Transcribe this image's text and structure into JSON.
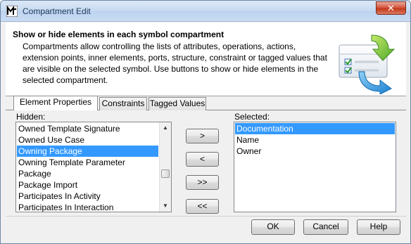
{
  "window": {
    "title": "Compartment Edit",
    "close_label": "✕"
  },
  "header": {
    "title": "Show or hide elements in each symbol compartment",
    "description": "Compartments allow controlling the lists of attributes, operations, actions, extension points, inner elements, ports, structure, constraint or tagged values that are visible on the selected symbol. Use buttons to show or hide elements in the selected compartment.",
    "graphic": "compartment-check-icon"
  },
  "tabs": [
    {
      "label": "Element Properties",
      "active": true
    },
    {
      "label": "Constraints",
      "active": false
    },
    {
      "label": "Tagged Values",
      "active": false
    }
  ],
  "hidden": {
    "label": "Hidden:",
    "items": [
      {
        "label": "Owned Template Signature",
        "selected": false
      },
      {
        "label": "Owned Use Case",
        "selected": false
      },
      {
        "label": "Owning Package",
        "selected": true
      },
      {
        "label": "Owning Template Parameter",
        "selected": false
      },
      {
        "label": "Package",
        "selected": false
      },
      {
        "label": "Package Import",
        "selected": false
      },
      {
        "label": "Participates In Activity",
        "selected": false
      },
      {
        "label": "Participates In Interaction",
        "selected": false
      }
    ],
    "scroll_position": 0.62
  },
  "selected": {
    "label": "Selected:",
    "items": [
      {
        "label": "Documentation",
        "selected": true
      },
      {
        "label": "Name",
        "selected": false
      },
      {
        "label": "Owner",
        "selected": false
      }
    ]
  },
  "move_buttons": {
    "show_one": ">",
    "hide_one": "<",
    "show_all": ">>",
    "hide_all": "<<"
  },
  "footer": {
    "ok_label": "OK",
    "cancel_label": "Cancel",
    "help_label": "Help"
  },
  "colors": {
    "selection": "#3399ff",
    "titlebar": "#c7daf1",
    "close_button": "#c4391b"
  }
}
